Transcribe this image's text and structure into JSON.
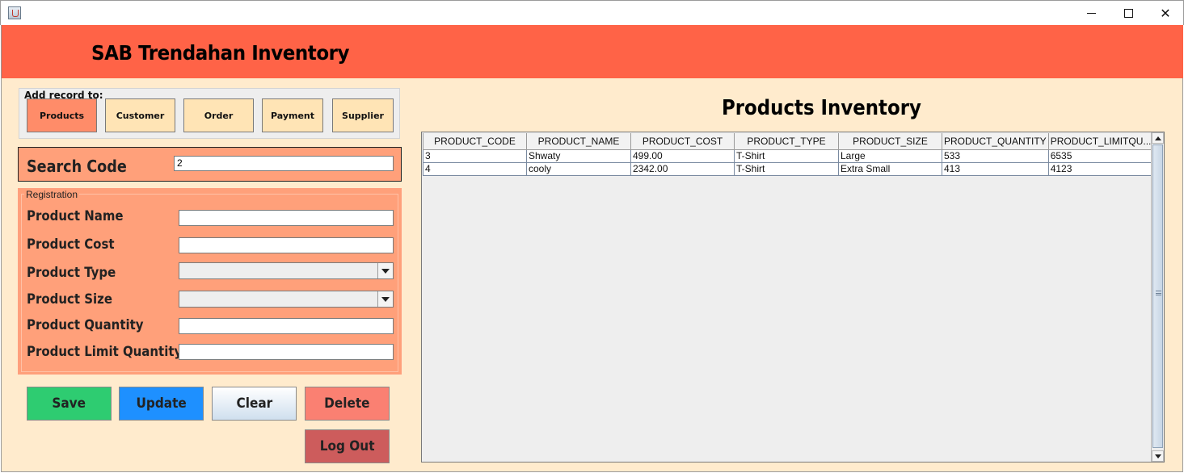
{
  "window": {
    "minimize_glyph": "",
    "maximize_glyph": "",
    "close_glyph": "✕"
  },
  "header": {
    "title": "SAB Trendahan Inventory"
  },
  "add_record": {
    "label": "Add record to:",
    "buttons": [
      "Products",
      "Customer",
      "Order",
      "Payment",
      "Supplier"
    ],
    "active": "Products"
  },
  "search": {
    "label": "Search Code",
    "value": "2"
  },
  "registration": {
    "legend": "Registration",
    "fields": {
      "product_name": {
        "label": "Product Name",
        "value": ""
      },
      "product_cost": {
        "label": "Product Cost",
        "value": ""
      },
      "product_type": {
        "label": "Product Type",
        "value": ""
      },
      "product_size": {
        "label": "Product Size",
        "value": ""
      },
      "product_quantity": {
        "label": "Product Quantity",
        "value": ""
      },
      "product_limit_quantity": {
        "label": "Product Limit Quantity",
        "value": ""
      }
    }
  },
  "actions": {
    "save": "Save",
    "update": "Update",
    "clear": "Clear",
    "delete": "Delete",
    "logout": "Log Out"
  },
  "inventory": {
    "title": "Products Inventory",
    "columns": [
      "PRODUCT_CODE",
      "PRODUCT_NAME",
      "PRODUCT_COST",
      "PRODUCT_TYPE",
      "PRODUCT_SIZE",
      "PRODUCT_QUANTITY",
      "PRODUCT_LIMITQU..."
    ],
    "rows": [
      [
        "3",
        "Shwaty",
        "499.00",
        "T-Shirt",
        "Large",
        "533",
        "6535"
      ],
      [
        "4",
        "cooly",
        "2342.00",
        "T-Shirt",
        "Extra Small",
        "413",
        "4123"
      ]
    ]
  },
  "colors": {
    "header": "#ff6347",
    "background": "#ffebcd",
    "panel": "#ffa07a",
    "save": "#2ecc71",
    "update": "#1e90ff",
    "delete": "#fa8072",
    "logout": "#cd5c5c"
  }
}
